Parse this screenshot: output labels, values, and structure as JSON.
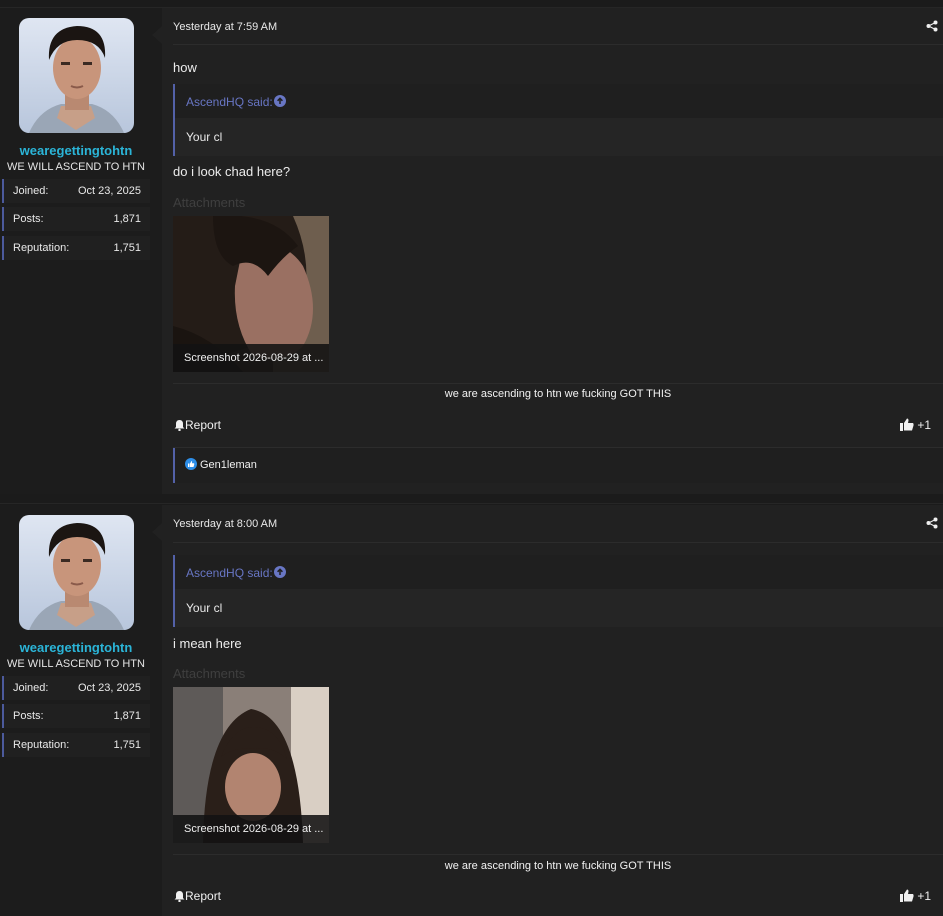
{
  "signature": "we are ascending to htn we fucking GOT THIS",
  "posts": [
    {
      "user": {
        "name": "wearegettingtohtn",
        "title": "WE WILL ASCEND TO HTN",
        "stats": [
          {
            "label": "Joined:",
            "value": "Oct 23, 2025"
          },
          {
            "label": "Posts:",
            "value": "1,871"
          },
          {
            "label": "Reputation:",
            "value": "1,751"
          }
        ]
      },
      "date": "Yesterday at 7:59 AM",
      "text_before_quote": "how",
      "quote": {
        "attribution": "AscendHQ said:",
        "text": "Your cl"
      },
      "text_after_quote": "do i look chad here?",
      "attachments_label": "Attachments",
      "attachment_caption": "Screenshot 2026-08-29 at ...",
      "report_label": "Report",
      "like_label": "+1",
      "reaction_user": "Gen1leman"
    },
    {
      "user": {
        "name": "wearegettingtohtn",
        "title": "WE WILL ASCEND TO HTN",
        "stats": [
          {
            "label": "Joined:",
            "value": "Oct 23, 2025"
          },
          {
            "label": "Posts:",
            "value": "1,871"
          },
          {
            "label": "Reputation:",
            "value": "1,751"
          }
        ]
      },
      "date": "Yesterday at 8:00 AM",
      "quote": {
        "attribution": "AscendHQ said:",
        "text": "Your cl"
      },
      "text_after_quote": "i mean here",
      "attachments_label": "Attachments",
      "attachment_caption": "Screenshot 2026-08-29 at ...",
      "report_label": "Report",
      "like_label": "+1"
    }
  ],
  "icons": {
    "share": "share-icon",
    "quote_link": "arrow-up-circle-icon",
    "report": "bell-icon",
    "like": "thumbs-up-icon",
    "reaction": "like-reaction-icon"
  },
  "colors": {
    "username": "#2bb5d8",
    "quote_attribution": "#6876c4",
    "accent_border": "#5361a8"
  }
}
